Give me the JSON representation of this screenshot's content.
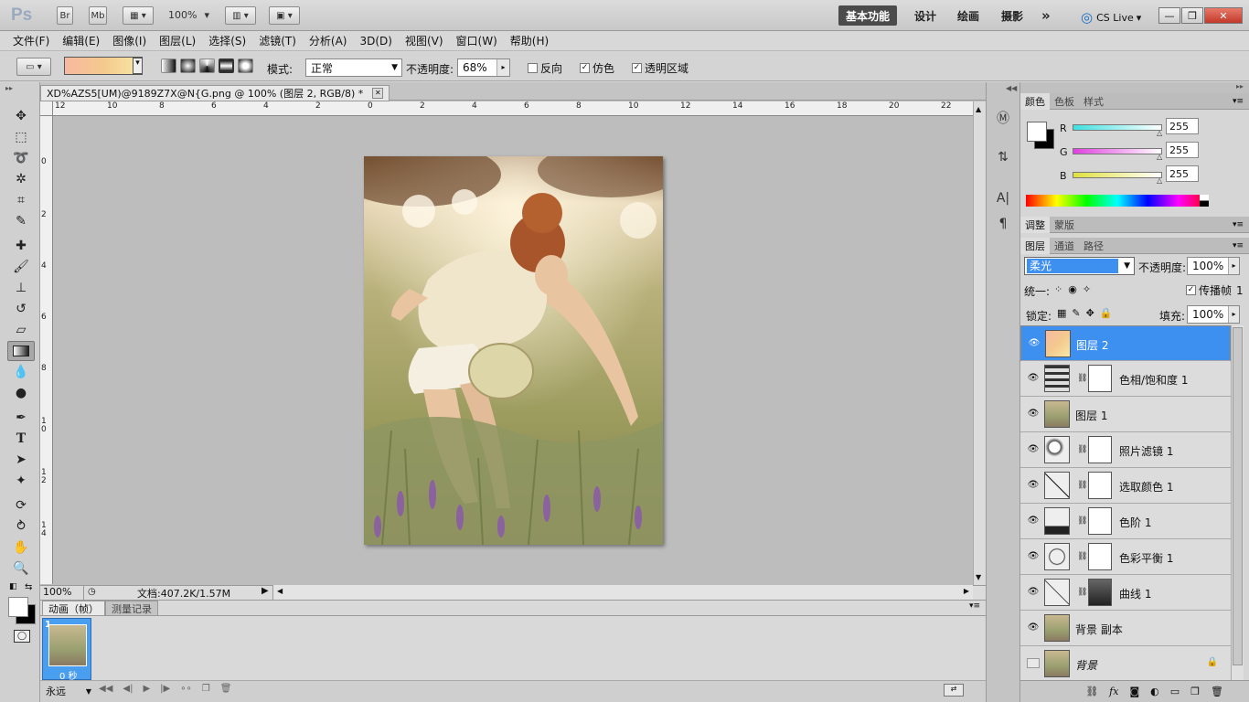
{
  "app": {
    "logo": "Ps",
    "br": "Br",
    "mb": "Mb",
    "zoom": "100%"
  },
  "workspaces": [
    "基本功能",
    "设计",
    "绘画",
    "摄影"
  ],
  "workspace_more": "»",
  "cslive": "CS Live",
  "window_controls": {
    "minimize": "—",
    "restore": "❐",
    "close": "✕"
  },
  "menu": [
    "文件(F)",
    "编辑(E)",
    "图像(I)",
    "图层(L)",
    "选择(S)",
    "滤镜(T)",
    "分析(A)",
    "3D(D)",
    "视图(V)",
    "窗口(W)",
    "帮助(H)"
  ],
  "options": {
    "mode_label": "模式:",
    "mode_value": "正常",
    "opacity_label": "不透明度:",
    "opacity_value": "68%",
    "reverse": "反向",
    "dither": "仿色",
    "transparency": "透明区域"
  },
  "document": {
    "tab_title": "XD%AZS5[UM)@9189Z7X@N{G.png @ 100% (图层 2, RGB/8) *",
    "close": "✕",
    "hruler": [
      "12",
      "10",
      "8",
      "6",
      "4",
      "2",
      "0",
      "2",
      "4",
      "6",
      "8",
      "10",
      "12",
      "14",
      "16",
      "18",
      "20",
      "22"
    ],
    "vruler": [
      "0",
      "2",
      "4",
      "6",
      "8",
      "1\n0",
      "1\n2",
      "1\n4"
    ],
    "zoom": "100%",
    "doc_info": "文档:407.2K/1.57M"
  },
  "animation": {
    "tabs": [
      "动画（帧）",
      "测量记录"
    ],
    "frame_number": "1",
    "frame_time": "0 秒",
    "loop": "永远"
  },
  "color_panel": {
    "tabs": [
      "颜色",
      "色板",
      "样式"
    ],
    "channels": [
      {
        "label": "R",
        "value": "255",
        "color": "#40e0e0"
      },
      {
        "label": "G",
        "value": "255",
        "color": "#e040e0"
      },
      {
        "label": "B",
        "value": "255",
        "color": "#e0e040"
      }
    ]
  },
  "adjust_tabs": [
    "调整",
    "蒙版"
  ],
  "layers_panel": {
    "tabs": [
      "图层",
      "通道",
      "路径"
    ],
    "blend_mode": "柔光",
    "opacity_label": "不透明度:",
    "opacity_value": "100%",
    "unify_label": "统一:",
    "propagate_label": "传播帧",
    "propagate_value": "1",
    "lock_label": "锁定:",
    "fill_label": "填充:",
    "fill_value": "100%",
    "layers": [
      {
        "name": "图层 2",
        "selected": true,
        "mask": false,
        "thumb": "gradient"
      },
      {
        "name": "色相/饱和度 1",
        "selected": false,
        "mask": true,
        "thumb": "hue"
      },
      {
        "name": "图层 1",
        "selected": false,
        "mask": false,
        "thumb": "photo"
      },
      {
        "name": "照片滤镜 1",
        "selected": false,
        "mask": true,
        "thumb": "filter"
      },
      {
        "name": "选取颜色 1",
        "selected": false,
        "mask": true,
        "thumb": "selective"
      },
      {
        "name": "色阶 1",
        "selected": false,
        "mask": true,
        "thumb": "levels"
      },
      {
        "name": "色彩平衡 1",
        "selected": false,
        "mask": true,
        "thumb": "balance"
      },
      {
        "name": "曲线 1",
        "selected": false,
        "mask": true,
        "thumb": "curves"
      },
      {
        "name": "背景 副本",
        "selected": false,
        "mask": false,
        "thumb": "photo"
      },
      {
        "name": "背景",
        "selected": false,
        "mask": false,
        "thumb": "photo",
        "italic": true,
        "hidden": true
      }
    ]
  }
}
